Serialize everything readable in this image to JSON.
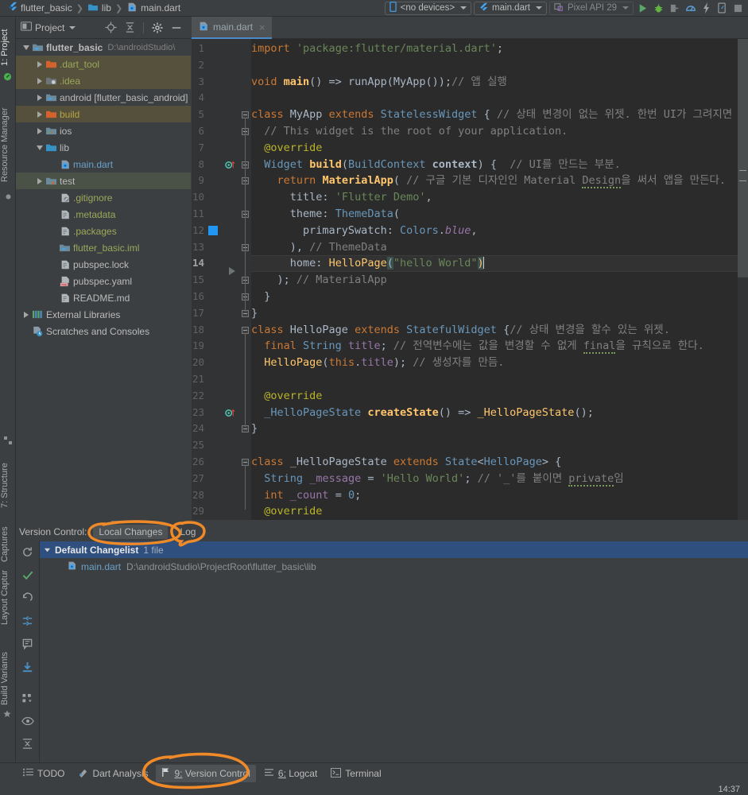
{
  "window": {
    "breadcrumb": [
      {
        "label": "flutter_basic",
        "icon": "flutter-icon"
      },
      {
        "label": "lib",
        "icon": "folder-icon"
      },
      {
        "label": "main.dart",
        "icon": "dart-file-icon"
      }
    ],
    "device_selector": "<no devices>",
    "run_config": "main.dart",
    "emulator": "Pixel API 29",
    "toolbar_icons": [
      "run-icon",
      "debug-icon",
      "profile-icon",
      "inspect-icon",
      "hot-reload-icon",
      "device-icon",
      "stop-icon"
    ]
  },
  "left_strip": [
    {
      "label": "1: Project",
      "selected": true
    },
    {
      "label": "Resource Manager",
      "selected": false
    },
    {
      "label": "7: Structure",
      "selected": false
    },
    {
      "label": "Captures",
      "selected": false
    }
  ],
  "project_panel": {
    "title": "Project",
    "toolbar_icons": [
      "locate-icon",
      "collapse-all-icon",
      "settings-gear-icon",
      "hide-icon"
    ],
    "tree": [
      {
        "depth": 0,
        "arrow": "down",
        "icon": "module-icon",
        "label": "flutter_basic",
        "path": "D:\\androidStudio\\",
        "bold": true,
        "color": "white",
        "highlight": "none"
      },
      {
        "depth": 1,
        "arrow": "right",
        "icon": "folder-excluded-icon",
        "label": ".dart_tool",
        "path": "",
        "bold": false,
        "color": "green",
        "highlight": "dart"
      },
      {
        "depth": 1,
        "arrow": "right",
        "icon": "folder-idea-icon",
        "label": ".idea",
        "path": "",
        "bold": false,
        "color": "green",
        "highlight": "idea"
      },
      {
        "depth": 1,
        "arrow": "right",
        "icon": "module-icon",
        "label": "android [flutter_basic_android]",
        "path": "",
        "bold": false,
        "color": "white",
        "highlight": "none"
      },
      {
        "depth": 1,
        "arrow": "right",
        "icon": "folder-excluded-icon",
        "label": "build",
        "path": "",
        "bold": false,
        "color": "yellow",
        "highlight": "build"
      },
      {
        "depth": 1,
        "arrow": "right",
        "icon": "folder-ios-icon",
        "label": "ios",
        "path": "",
        "bold": false,
        "color": "white",
        "highlight": "none"
      },
      {
        "depth": 1,
        "arrow": "down",
        "icon": "folder-source-icon",
        "label": "lib",
        "path": "",
        "bold": false,
        "color": "white",
        "highlight": "none"
      },
      {
        "depth": 2,
        "arrow": "none",
        "icon": "dart-file-icon",
        "label": "main.dart",
        "path": "",
        "bold": false,
        "color": "blue",
        "highlight": "none"
      },
      {
        "depth": 1,
        "arrow": "right",
        "icon": "folder-test-icon",
        "label": "test",
        "path": "",
        "bold": false,
        "color": "white",
        "highlight": "test"
      },
      {
        "depth": 2,
        "arrow": "none",
        "icon": "gitignore-icon",
        "label": ".gitignore",
        "path": "",
        "bold": false,
        "color": "green",
        "highlight": "none"
      },
      {
        "depth": 2,
        "arrow": "none",
        "icon": "file-icon",
        "label": ".metadata",
        "path": "",
        "bold": false,
        "color": "green",
        "highlight": "none"
      },
      {
        "depth": 2,
        "arrow": "none",
        "icon": "file-icon",
        "label": ".packages",
        "path": "",
        "bold": false,
        "color": "green",
        "highlight": "none"
      },
      {
        "depth": 2,
        "arrow": "none",
        "icon": "module-icon",
        "label": "flutter_basic.iml",
        "path": "",
        "bold": false,
        "color": "green",
        "highlight": "none"
      },
      {
        "depth": 2,
        "arrow": "none",
        "icon": "file-icon",
        "label": "pubspec.lock",
        "path": "",
        "bold": false,
        "color": "white",
        "highlight": "none"
      },
      {
        "depth": 2,
        "arrow": "none",
        "icon": "yaml-icon",
        "label": "pubspec.yaml",
        "path": "",
        "bold": false,
        "color": "white",
        "highlight": "none"
      },
      {
        "depth": 2,
        "arrow": "none",
        "icon": "file-icon",
        "label": "README.md",
        "path": "",
        "bold": false,
        "color": "white",
        "highlight": "none"
      },
      {
        "depth": 0,
        "arrow": "right",
        "icon": "libraries-icon",
        "label": "External Libraries",
        "path": "",
        "bold": false,
        "color": "white",
        "highlight": "none"
      },
      {
        "depth": 0,
        "arrow": "none",
        "icon": "scratches-icon",
        "label": "Scratches and Consoles",
        "path": "",
        "bold": false,
        "color": "white",
        "highlight": "none"
      }
    ]
  },
  "editor": {
    "tab": {
      "label": "main.dart",
      "close": "×"
    },
    "caret_line": 14,
    "lines": [
      {
        "n": 1,
        "html": "<span class=\"kw\">import</span> <span class=\"str\">'package:flutter/material.dart'</span><span class=\"plain\">;</span>"
      },
      {
        "n": 2,
        "html": ""
      },
      {
        "n": 3,
        "html": "<span class=\"kw\">void</span> <span class=\"fn bold\">main</span><span class=\"plain\">() =&gt; </span><span class=\"plain\">runApp(</span><span class=\"typ\">MyApp</span><span class=\"plain\">());</span><span class=\"cmt\">// 앱 실행</span>"
      },
      {
        "n": 4,
        "html": ""
      },
      {
        "n": 5,
        "html": "<span class=\"kw\">class</span> <span class=\"typ\">MyApp</span> <span class=\"kw\">extends</span> <span class=\"cls\">StatelessWidget</span> <span class=\"plain\">{</span> <span class=\"cmt\">// 상태 변경이 없는 위젯. 한번 UI가 그려지면 그</span>"
      },
      {
        "n": 6,
        "html": "  <span class=\"cmt\">// This widget is the root of your application.</span>"
      },
      {
        "n": 7,
        "html": "  <span class=\"ann\">@override</span>"
      },
      {
        "n": 8,
        "html": "  <span class=\"cls\">Widget</span> <span class=\"fn bold\">build</span><span class=\"plain\">(</span><span class=\"cls\">BuildContext</span> <span class=\"plain bold\">context</span><span class=\"plain\">) {</span>  <span class=\"cmt\">// UI를 만드는 부분.</span>"
      },
      {
        "n": 9,
        "html": "    <span class=\"kw\">return</span> <span class=\"fn bold\">MaterialApp</span><span class=\"plain\">(</span> <span class=\"cmt\">// 구글 기본 디자인인 Material <span class=\"squig\">Design</span>을 써서 앱을 만든다.</span>"
      },
      {
        "n": 10,
        "html": "      <span class=\"plain\">title:</span> <span class=\"str\">'Flutter Demo'</span><span class=\"plain\">,</span>"
      },
      {
        "n": 11,
        "html": "      <span class=\"plain\">theme:</span> <span class=\"cls\">ThemeData</span><span class=\"plain\">(</span>"
      },
      {
        "n": 12,
        "html": "        <span class=\"plain\">primarySwatch:</span> <span class=\"cls\">Colors</span><span class=\"plain\">.</span><span class=\"fld\" style=\"font-style:italic\">blue</span><span class=\"plain\">,</span>"
      },
      {
        "n": 13,
        "html": "      <span class=\"plain\">),</span> <span class=\"cmt\">// ThemeData</span>"
      },
      {
        "n": 14,
        "html": "      <span class=\"plain\">home:</span> <span class=\"fn\">HelloPage</span><span class=\"mbrace plain\">(</span><span class=\"str\">\"hello World\"</span><span class=\"mbrace fn\">)</span><span class=\"caret\"></span>"
      },
      {
        "n": 15,
        "html": "    <span class=\"plain\">);</span> <span class=\"cmt\">// MaterialApp</span>"
      },
      {
        "n": 16,
        "html": "  <span class=\"plain\">}</span>"
      },
      {
        "n": 17,
        "html": "<span class=\"plain\">}</span>"
      },
      {
        "n": 18,
        "html": "<span class=\"kw\">class</span> <span class=\"typ\">HelloPage</span> <span class=\"kw\">extends</span> <span class=\"cls\">StatefulWidget</span> <span class=\"plain\">{</span><span class=\"cmt\">// 상태 변경을 할수 있는 위젯.</span>"
      },
      {
        "n": 19,
        "html": "  <span class=\"kw\">final</span> <span class=\"cls\">String</span> <span class=\"fld\">title</span><span class=\"plain\">;</span> <span class=\"cmt\">// 전역변수에는 값을 변경할 수 없게 <span class=\"squig\">final</span>을 규칙으로 한다.</span>"
      },
      {
        "n": 20,
        "html": "  <span class=\"fn\">HelloPage</span><span class=\"plain\">(</span><span class=\"kw\">this</span><span class=\"plain\">.</span><span class=\"fld\">title</span><span class=\"plain\">);</span> <span class=\"cmt\">// 생성자를 만듬.</span>"
      },
      {
        "n": 21,
        "html": ""
      },
      {
        "n": 22,
        "html": "  <span class=\"ann\">@override</span>"
      },
      {
        "n": 23,
        "html": "  <span class=\"cls\">_HelloPageState</span> <span class=\"fn bold\">createState</span><span class=\"plain\">() =&gt; </span><span class=\"fn\">_HelloPageState</span><span class=\"plain\">();</span>"
      },
      {
        "n": 24,
        "html": "<span class=\"plain\">}</span>"
      },
      {
        "n": 25,
        "html": ""
      },
      {
        "n": 26,
        "html": "<span class=\"kw\">class</span> <span class=\"typ\">_HelloPageState</span> <span class=\"kw\">extends</span> <span class=\"cls\">State</span><span class=\"plain\">&lt;</span><span class=\"cls\">HelloPage</span><span class=\"plain\">&gt; {</span>"
      },
      {
        "n": 27,
        "html": "  <span class=\"cls\">String</span> <span class=\"fld\">_message</span> <span class=\"plain\">=</span> <span class=\"str\">'Hello World'</span><span class=\"plain\">;</span> <span class=\"cmt\">// '_'를 붙이면 <span class=\"squig\">private</span>임</span>"
      },
      {
        "n": 28,
        "html": "  <span class=\"kw\">int</span> <span class=\"fld\">_count</span> <span class=\"plain\">=</span> <span class=\"num\">0</span><span class=\"plain\">;</span>"
      },
      {
        "n": 29,
        "html": "  <span class=\"ann\">@override</span>"
      }
    ]
  },
  "version_control": {
    "label": "Version Control:",
    "tabs": [
      {
        "label": "Local Changes",
        "active": true,
        "annotated": true
      },
      {
        "label": "Log",
        "active": false,
        "annotated": true
      }
    ],
    "sidebar_icons": [
      "refresh-icon",
      "commit-check-icon",
      "rollback-icon",
      "shelve-icon",
      "show-diff-icon",
      "update-icon",
      "group-by-icon",
      "preview-eye-icon",
      "expand-collapse-icon",
      "more-chevrons-icon"
    ],
    "changelist": {
      "name": "Default Changelist",
      "count": "1 file",
      "files": [
        {
          "name": "main.dart",
          "path": "D:\\androidStudio\\ProjectRoot\\flutter_basic\\lib"
        }
      ]
    }
  },
  "status_bar": {
    "items": [
      {
        "label": "TODO",
        "icon": "todo-icon",
        "active": false,
        "mnemonic": ""
      },
      {
        "label": "Dart Analysis",
        "icon": "dart-analysis-icon",
        "active": false,
        "mnemonic": ""
      },
      {
        "label": "Version Control",
        "icon": "vcs-branch-icon",
        "active": true,
        "mnemonic": "9:",
        "annotated": true
      },
      {
        "label": "Logcat",
        "icon": "logcat-icon",
        "active": false,
        "mnemonic": "6:"
      },
      {
        "label": "Terminal",
        "icon": "terminal-icon",
        "active": false,
        "mnemonic": ""
      }
    ],
    "clock": "14:37"
  },
  "annotation_color": "#f08a28"
}
